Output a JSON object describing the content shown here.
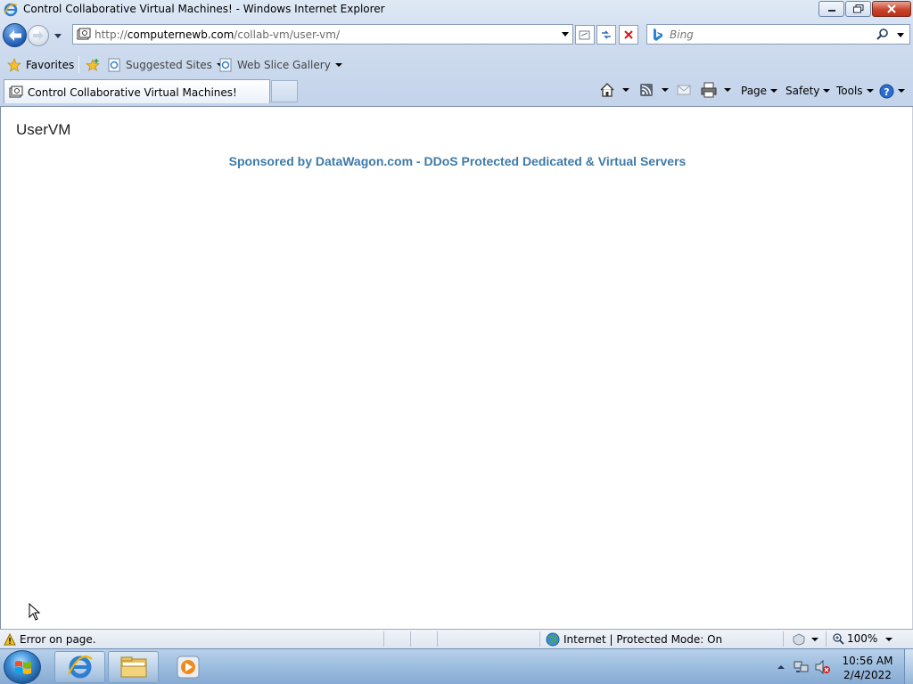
{
  "window": {
    "title": "Control Collaborative Virtual Machines! - Windows Internet Explorer"
  },
  "address_bar": {
    "url_prefix": "http://",
    "url_domain": "computernewb.com",
    "url_path": "/collab-vm/user-vm/"
  },
  "search": {
    "placeholder": "Bing"
  },
  "favorites_bar": {
    "favorites_label": "Favorites",
    "suggested_sites_label": "Suggested Sites",
    "web_slice_gallery_label": "Web Slice Gallery"
  },
  "tabs": [
    {
      "label": "Control Collaborative Virtual Machines!"
    }
  ],
  "command_bar": {
    "page_label": "Page",
    "safety_label": "Safety",
    "tools_label": "Tools"
  },
  "page": {
    "title": "UserVM",
    "sponsor_text": "Sponsored by DataWagon.com - DDoS Protected Dedicated & Virtual Servers"
  },
  "status_bar": {
    "message": "Error on page.",
    "zone": "Internet | Protected Mode: On",
    "zoom": "100%"
  },
  "taskbar": {
    "time": "10:56 AM",
    "date": "2/4/2022"
  },
  "colors": {
    "sponsor_link": "#3f7aa7",
    "chrome_bg": "#cfdcee",
    "taskbar_bg": "#9fbfe0"
  }
}
